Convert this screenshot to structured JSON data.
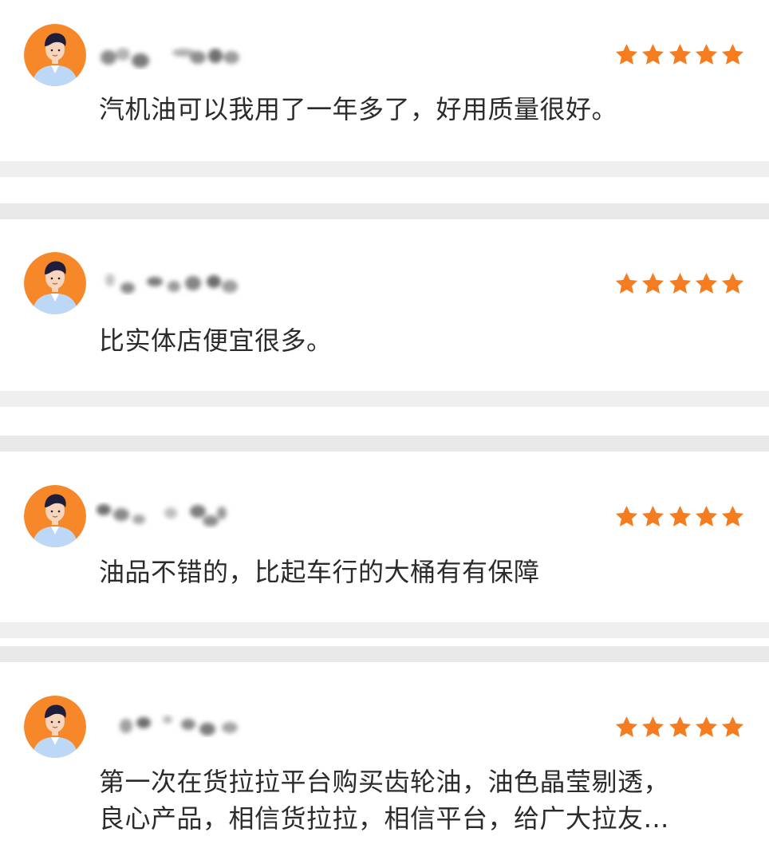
{
  "reviews": [
    {
      "reviewer_name": "",
      "rating": 5,
      "text": "汽机油可以我用了一年多了，好用质量很好。"
    },
    {
      "reviewer_name": "",
      "rating": 5,
      "text": "比实体店便宜很多。"
    },
    {
      "reviewer_name": "",
      "rating": 5,
      "text": "油品不错的，比起车行的大桶有有保障"
    },
    {
      "reviewer_name": "",
      "rating": 5,
      "text": "第一次在货拉拉平台购买齿轮油，油色晶莹剔透，\n良心产品，相信货拉拉，相信平台，给广大拉友…"
    }
  ],
  "colors": {
    "star": "#f57c1f",
    "avatar_bg": "#f6882a",
    "text": "#2b2b2b",
    "separator": "#efefef"
  },
  "icons": {
    "avatar": "user-avatar-icon",
    "star": "star-icon"
  }
}
